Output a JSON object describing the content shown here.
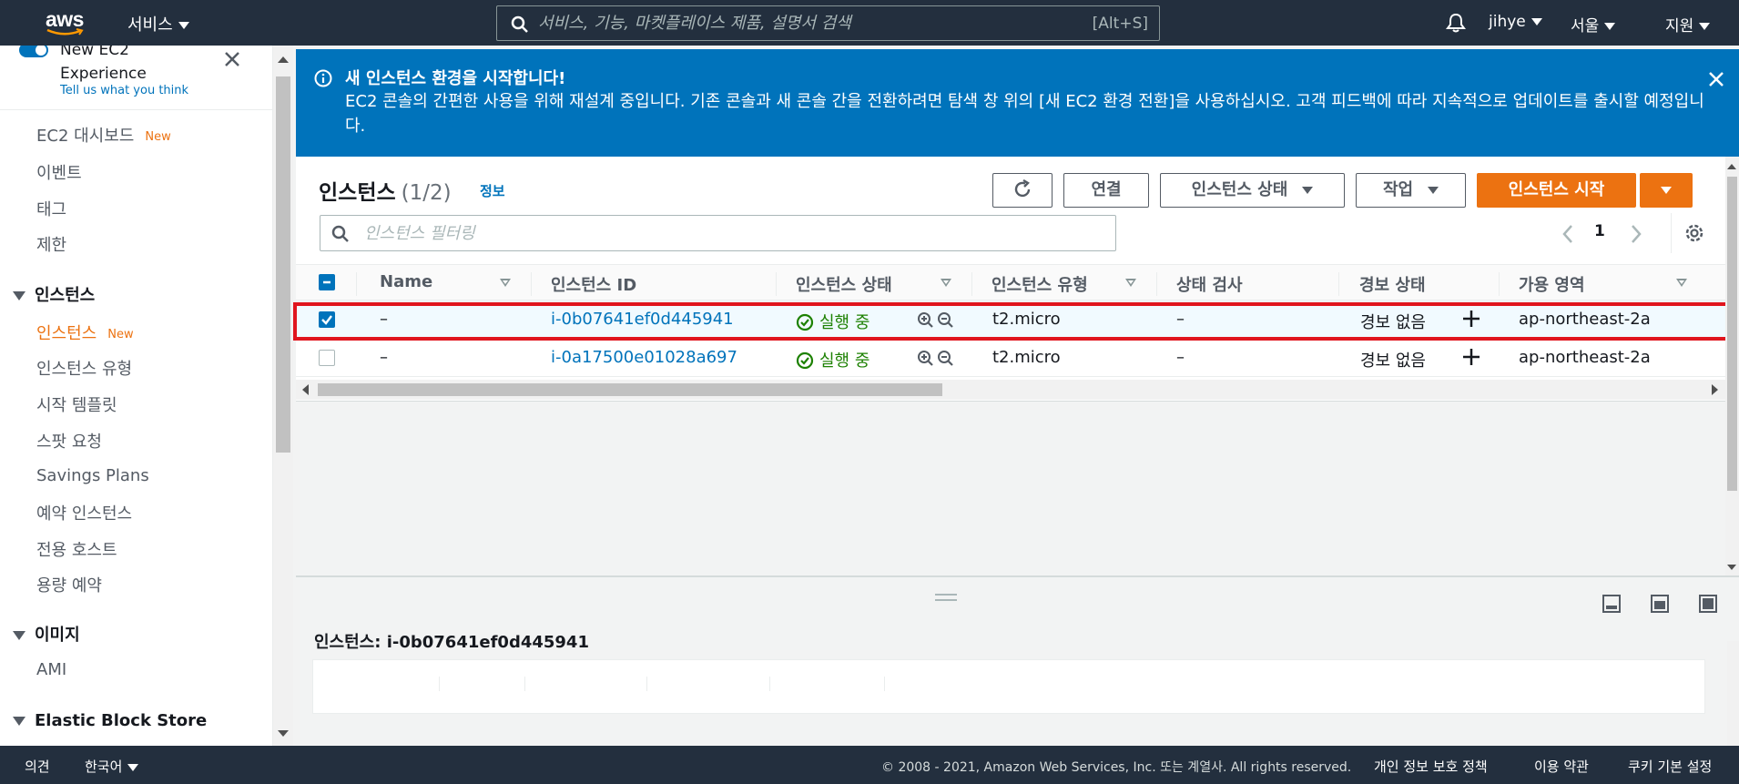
{
  "topnav": {
    "logo": "aws",
    "services_label": "서비스",
    "search_placeholder": "서비스, 기능, 마켓플레이스 제품, 설명서 검색",
    "search_shortcut": "[Alt+S]",
    "user": "jihye",
    "region": "서울",
    "support": "지원"
  },
  "sidebar": {
    "new_experience": "New EC2 Experience",
    "new_experience_line1": "New EC2",
    "new_experience_line2": "Experience",
    "tell_us": "Tell us what you think",
    "new_badge": "New",
    "items": [
      {
        "label": "EC2 대시보드",
        "badge": "New"
      },
      {
        "label": "이벤트"
      },
      {
        "label": "태그"
      },
      {
        "label": "제한"
      }
    ],
    "sections": [
      {
        "label": "인스턴스",
        "items": [
          "인스턴스",
          "인스턴스 유형",
          "시작 템플릿",
          "스팟 요청",
          "Savings Plans",
          "예약 인스턴스",
          "전용 호스트",
          "용량 예약"
        ]
      },
      {
        "label": "이미지",
        "items": [
          "AMI"
        ]
      },
      {
        "label": "Elastic Block Store",
        "items": []
      }
    ]
  },
  "banner": {
    "title": "새 인스턴스 환경을 시작합니다!",
    "body": "EC2 콘솔의 간편한 사용을 위해 재설계 중입니다. 기존 콘솔과 새 콘솔 간을 전환하려면 탐색 창 위의 [새 EC2 환경 전환]을 사용하십시오. 고객 피드백에 따라 지속적으로 업데이트를 출시할 예정입니다.",
    "color": "#0073bb"
  },
  "panel": {
    "title": "인스턴스",
    "count": "(1/2)",
    "info": "정보",
    "buttons": {
      "connect": "연결",
      "instance_state": "인스턴스 상태",
      "actions": "작업",
      "launch": "인스턴스 시작"
    },
    "filter_placeholder": "인스턴스 필터링",
    "page": "1"
  },
  "table": {
    "columns": [
      "Name",
      "인스턴스 ID",
      "인스턴스 상태",
      "인스턴스 유형",
      "상태 검사",
      "경보 상태",
      "가용 영역"
    ],
    "rows": [
      {
        "selected": true,
        "name": "–",
        "id": "i-0b07641ef0d445941",
        "state": "실행 중",
        "type": "t2.micro",
        "check": "–",
        "alarm": "경보 없음",
        "az": "ap-northeast-2a"
      },
      {
        "selected": false,
        "name": "–",
        "id": "i-0a17500e01028a697",
        "state": "실행 중",
        "type": "t2.micro",
        "check": "–",
        "alarm": "경보 없음",
        "az": "ap-northeast-2a"
      }
    ]
  },
  "split_panel": {
    "title": "인스턴스: i-0b07641ef0d445941"
  },
  "footer": {
    "feedback": "의견",
    "language": "한국어",
    "copyright": "© 2008 - 2021, Amazon Web Services, Inc. 또는 계열사. All rights reserved.",
    "privacy": "개인 정보 보호 정책",
    "terms": "이용 약관",
    "cookies": "쿠키 기본 설정"
  },
  "colors": {
    "nav_bg": "#232f3e",
    "accent": "#ec7211",
    "link": "#0073bb",
    "running": "#1d8102",
    "highlight": "#e0151e"
  }
}
